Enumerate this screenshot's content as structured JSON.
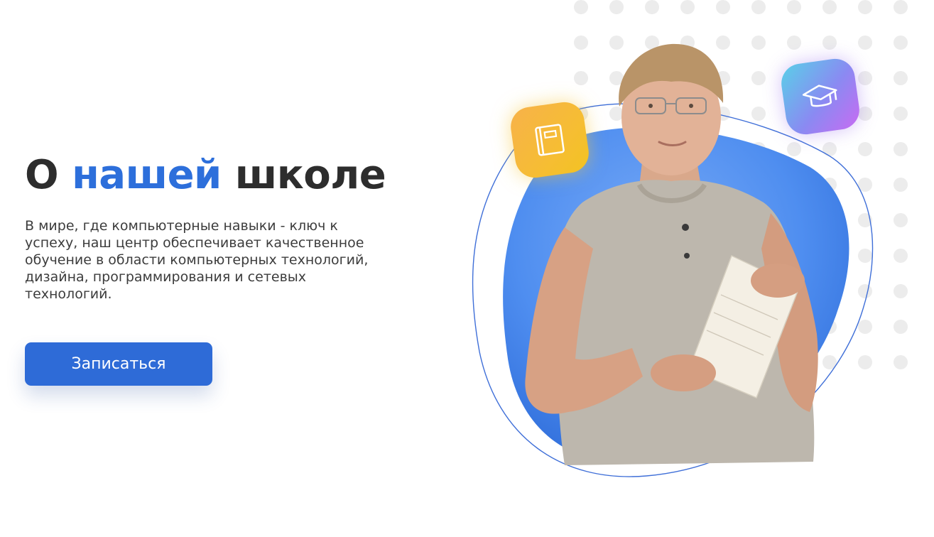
{
  "hero": {
    "title_prefix": "О",
    "title_accent": "нашей",
    "title_suffix": "школе",
    "description": "В мире, где компьютерные навыки - ключ к успеху, наш центр обеспечивает качественное обучение в области компьютерных технологий, дизайна, программирования и сетевых технологий.",
    "cta_label": "Записаться"
  },
  "illustration": {
    "icons": [
      "book-icon",
      "graduation-cap-icon"
    ],
    "photo": "teacher-photo"
  },
  "colors": {
    "accent": "#2d6fdb",
    "heading": "#2d2d2d",
    "body_text": "#3c3c3c",
    "button": "#2e6bd7",
    "blob": "#4f8ef0",
    "dots": "#ececec"
  }
}
